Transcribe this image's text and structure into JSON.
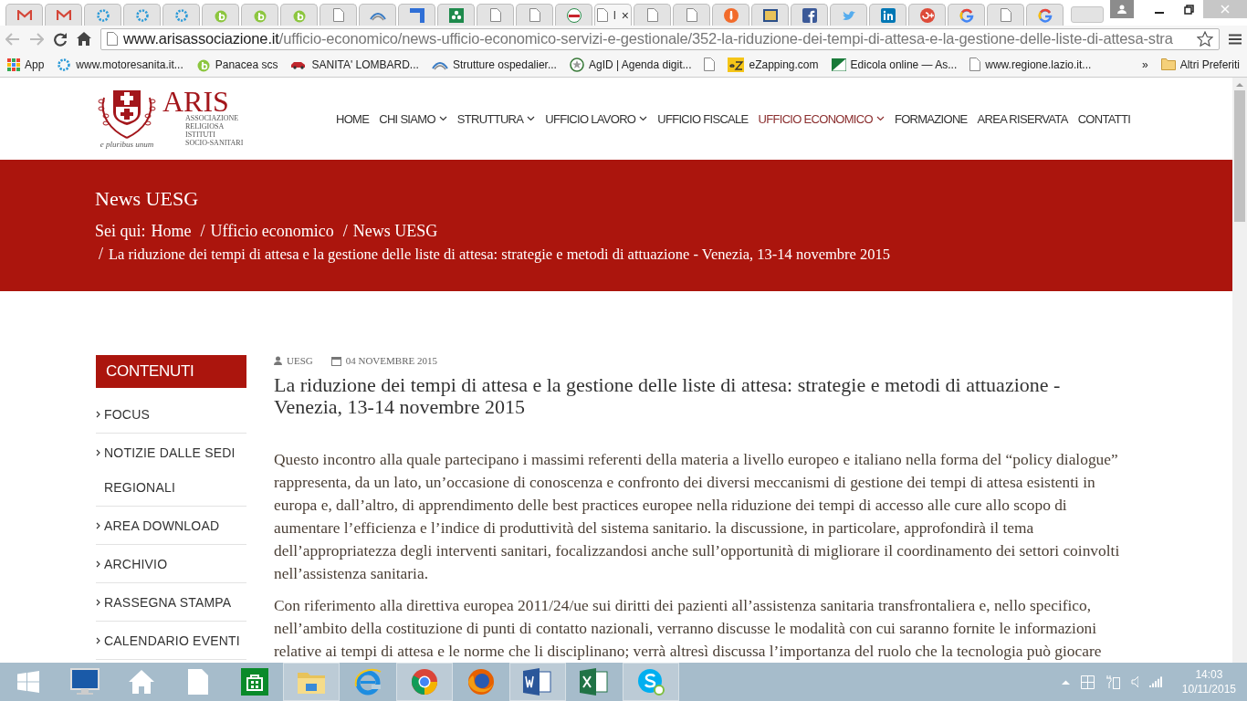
{
  "browser": {
    "tabs": [
      {
        "kind": "gmail",
        "selected": false
      },
      {
        "kind": "gmail",
        "selected": false
      },
      {
        "kind": "gear",
        "selected": false
      },
      {
        "kind": "gear",
        "selected": false
      },
      {
        "kind": "gear",
        "selected": false
      },
      {
        "kind": "leaf",
        "selected": false
      },
      {
        "kind": "leaf",
        "selected": false
      },
      {
        "kind": "leaf",
        "selected": false
      },
      {
        "kind": "page",
        "selected": false
      },
      {
        "kind": "wave",
        "selected": false
      },
      {
        "kind": "bracket",
        "selected": false
      },
      {
        "kind": "flower",
        "selected": false
      },
      {
        "kind": "page",
        "selected": false
      },
      {
        "kind": "page",
        "selected": false
      },
      {
        "kind": "badge",
        "selected": false
      },
      {
        "kind": "page",
        "selected": true,
        "title": "l",
        "close": "×"
      },
      {
        "kind": "page",
        "selected": false
      },
      {
        "kind": "page",
        "selected": false
      },
      {
        "kind": "tie",
        "selected": false
      },
      {
        "kind": "photo",
        "selected": false
      },
      {
        "kind": "facebook",
        "selected": false
      },
      {
        "kind": "bird",
        "selected": false
      },
      {
        "kind": "linkedin",
        "selected": false
      },
      {
        "kind": "gplus",
        "selected": false
      },
      {
        "kind": "google",
        "selected": false
      },
      {
        "kind": "page",
        "selected": false
      },
      {
        "kind": "google",
        "selected": false
      }
    ],
    "url_host": "www.arisassociazione.it",
    "url_path": "/ufficio-economico/news-ufficio-economico-servizi-e-gestionale/352-la-riduzione-dei-tempi-di-attesa-e-la-gestione-delle-liste-di-attesa-stra",
    "bookmarks": [
      {
        "kind": "apps",
        "label": "App"
      },
      {
        "kind": "gear",
        "label": "www.motoresanita.it..."
      },
      {
        "kind": "leaf",
        "label": "Panacea scs"
      },
      {
        "kind": "car",
        "label": "SANITA' LOMBARD..."
      },
      {
        "kind": "wave",
        "label": "Strutture ospedalier..."
      },
      {
        "kind": "emblem",
        "label": "AgID | Agenda digit..."
      },
      {
        "kind": "page"
      },
      {
        "kind": "ez",
        "label": "eZapping.com"
      },
      {
        "kind": "flag",
        "label": "Edicola online — As..."
      },
      {
        "kind": "page",
        "label": "www.regione.lazio.it..."
      }
    ],
    "more": "»",
    "other_folder": "Altri Preferiti"
  },
  "site": {
    "logo": {
      "name": "ARIS",
      "lines": [
        "ASSOCIAZIONE",
        "RELIGIOSA",
        "ISTITUTI",
        "SOCIO-SANITARI"
      ],
      "motto": "e pluribus unum"
    },
    "nav": [
      {
        "label": "HOME",
        "dropdown": false,
        "selected": false
      },
      {
        "label": "CHI SIAMO",
        "dropdown": true,
        "selected": false
      },
      {
        "label": "STRUTTURA",
        "dropdown": true,
        "selected": false
      },
      {
        "label": "UFFICIO LAVORO",
        "dropdown": true,
        "selected": false
      },
      {
        "label": "UFFICIO FISCALE",
        "dropdown": false,
        "selected": false
      },
      {
        "label": "UFFICIO ECONOMICO",
        "dropdown": true,
        "selected": true
      },
      {
        "label": "FORMAZIONE",
        "dropdown": false,
        "selected": false
      },
      {
        "label": "AREA RISERVATA",
        "dropdown": false,
        "selected": false
      },
      {
        "label": "CONTATTI",
        "dropdown": false,
        "selected": false
      }
    ],
    "banner": {
      "title": "News UESG",
      "breadcrumb_label": "Sei qui:",
      "breadcrumb": [
        {
          "kind": "link",
          "text": "Home"
        },
        {
          "kind": "sep",
          "text": "/"
        },
        {
          "kind": "link",
          "text": "Ufficio economico"
        },
        {
          "kind": "sep",
          "text": "/"
        },
        {
          "kind": "link",
          "text": "News UESG"
        },
        {
          "kind": "break"
        },
        {
          "kind": "sep",
          "text": "/"
        },
        {
          "kind": "current",
          "text": "La riduzione dei tempi di attesa e la gestione delle liste di attesa: strategie e metodi di attuazione - Venezia, 13-14 novembre 2015"
        }
      ]
    },
    "sidebar": {
      "title": "CONTENUTI",
      "items": [
        "FOCUS",
        "NOTIZIE DALLE SEDI REGIONALI",
        "AREA DOWNLOAD",
        "ARCHIVIO",
        "RASSEGNA STAMPA",
        "CALENDARIO EVENTI"
      ]
    },
    "article": {
      "author": "UESG",
      "date": "04 NOVEMBRE 2015",
      "title": "La riduzione dei tempi di attesa e la gestione delle liste di attesa: strategie e metodi di attuazione - Venezia, 13-14 novembre 2015",
      "paragraphs": [
        "Questo incontro alla quale partecipano i massimi referenti della materia a livello europeo e italiano nella forma del “policy dialogue” rappresenta, da un lato, un’occasione di conoscenza e confronto dei diversi meccanismi di gestione dei tempi di attesa esistenti in europa e, dall’altro, di apprendimento delle best practices europee nella riduzione dei tempi di accesso alle cure allo scopo di aumentare l’efficienza e l’indice di produttività del sistema sanitario. la discussione, in particolare, approfondirà il tema dell’appropriatezza degli interventi sanitari, focalizzandosi anche sull’opportunità di migliorare il coordinamento dei settori coinvolti nell’assistenza sanitaria.",
        "Con riferimento alla direttiva europea 2011/24/ue sui diritti dei pazienti all’assistenza sanitaria transfrontaliera e, nello specifico, nell’ambito della costituzione di punti di contatto nazionali, verranno discusse le modalità con cui saranno fornite le informazioni relative ai tempi di attesa e le norme che li disciplinano; verrà altresì discussa l’importanza del ruolo che la tecnologia può giocare"
      ]
    }
  },
  "taskbar": {
    "apps": [
      {
        "kind": "start",
        "active": false
      },
      {
        "kind": "monitor",
        "active": false
      },
      {
        "kind": "home",
        "active": false
      },
      {
        "kind": "file",
        "active": false
      },
      {
        "kind": "store",
        "active": false
      },
      {
        "kind": "folder",
        "active": true
      },
      {
        "kind": "ie",
        "active": false
      },
      {
        "kind": "chrome",
        "active": true
      },
      {
        "kind": "firefox",
        "active": false
      },
      {
        "kind": "word",
        "active": true
      },
      {
        "kind": "excel",
        "active": false
      },
      {
        "kind": "skype",
        "active": true
      }
    ],
    "time": "14:03",
    "date": "10/11/2015"
  }
}
